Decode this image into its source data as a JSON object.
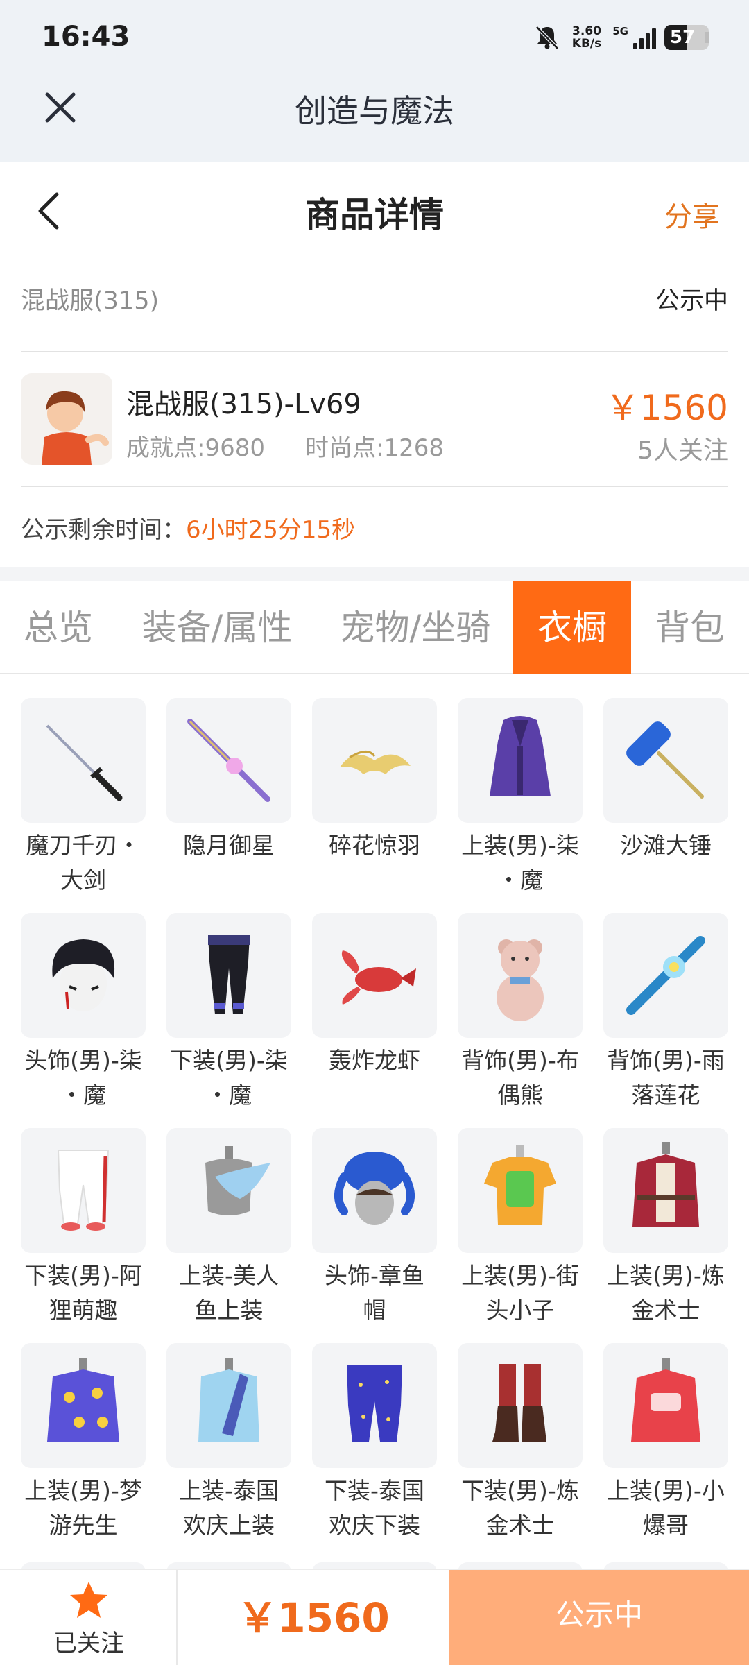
{
  "status_bar": {
    "time": "16:43",
    "net_speed_value": "3.60",
    "net_speed_unit": "KB/s",
    "network": "5G",
    "battery": "57",
    "battery_level": 0.57
  },
  "webview": {
    "title": "创造与魔法"
  },
  "nav": {
    "title": "商品详情",
    "share": "分享"
  },
  "listing": {
    "server": "混战服(315)",
    "status": "公示中",
    "character_name": "混战服(315)-Lv69",
    "achievement": "成就点:9680",
    "fashion": "时尚点:1268",
    "price": "￥1560",
    "followers": "5人关注",
    "remaining_label": "公示剩余时间：",
    "remaining_value": "6小时25分15秒"
  },
  "tabs": [
    {
      "label": "总览",
      "active": false
    },
    {
      "label": "装备/属性",
      "active": false
    },
    {
      "label": "宠物/坐骑",
      "active": false
    },
    {
      "label": "衣橱",
      "active": true
    },
    {
      "label": "背包",
      "active": false
    }
  ],
  "wardrobe": [
    {
      "name": "魔刀千刃·大剑",
      "line1": "魔刀千刃・",
      "line2": "大剑",
      "icon": "katana-icon"
    },
    {
      "name": "隐月御星",
      "line1": "隐月御星",
      "line2": "",
      "icon": "staff-sword-icon"
    },
    {
      "name": "碎花惊羽",
      "line1": "碎花惊羽",
      "line2": "",
      "icon": "golden-wings-icon"
    },
    {
      "name": "上装(男)-柒·魔",
      "line1": "上装(男)-柒",
      "line2": "・魔",
      "icon": "purple-coat-icon"
    },
    {
      "name": "沙滩大锤",
      "line1": "沙滩大锤",
      "line2": "",
      "icon": "hammer-icon"
    },
    {
      "name": "头饰(男)-柒·魔",
      "line1": "头饰(男)-柒",
      "line2": "・魔",
      "icon": "dark-hair-icon"
    },
    {
      "name": "下装(男)-柒·魔",
      "line1": "下装(男)-柒",
      "line2": "・魔",
      "icon": "dark-pants-icon"
    },
    {
      "name": "轰炸龙虾",
      "line1": "轰炸龙虾",
      "line2": "",
      "icon": "lobster-icon"
    },
    {
      "name": "背饰(男)-布偶熊",
      "line1": "背饰(男)-布",
      "line2": "偶熊",
      "icon": "teddy-bear-icon"
    },
    {
      "name": "背饰(男)-雨落莲花",
      "line1": "背饰(男)-雨",
      "line2": "落莲花",
      "icon": "lotus-umbrella-icon"
    },
    {
      "name": "下装(男)-阿狸萌趣",
      "line1": "下装(男)-阿",
      "line2": "狸萌趣",
      "icon": "white-pants-icon"
    },
    {
      "name": "上装-美人鱼上装",
      "line1": "上装-美人",
      "line2": "鱼上装",
      "icon": "mermaid-top-icon"
    },
    {
      "name": "头饰-章鱼帽",
      "line1": "头饰-章鱼",
      "line2": "帽",
      "icon": "octopus-hat-icon"
    },
    {
      "name": "上装(男)-街头小子",
      "line1": "上装(男)-街",
      "line2": "头小子",
      "icon": "street-shirt-icon"
    },
    {
      "name": "上装(男)-炼金术士",
      "line1": "上装(男)-炼",
      "line2": "金术士",
      "icon": "alchemist-coat-icon"
    },
    {
      "name": "上装(男)-梦游先生",
      "line1": "上装(男)-梦",
      "line2": "游先生",
      "icon": "pajama-top-icon"
    },
    {
      "name": "上装-泰国欢庆上装",
      "line1": "上装-泰国",
      "line2": "欢庆上装",
      "icon": "thai-top-icon"
    },
    {
      "name": "下装-泰国欢庆下装",
      "line1": "下装-泰国",
      "line2": "欢庆下装",
      "icon": "star-pants-icon"
    },
    {
      "name": "下装(男)-炼金术士",
      "line1": "下装(男)-炼",
      "line2": "金术士",
      "icon": "boots-icon"
    },
    {
      "name": "上装(男)-小爆哥",
      "line1": "上装(男)-小",
      "line2": "爆哥",
      "icon": "red-hoodie-icon"
    }
  ],
  "bottom_bar": {
    "follow_label": "已关注",
    "price": "￥1560",
    "status": "公示中"
  },
  "colors": {
    "accent": "#ff6a14",
    "price": "#f06a1c",
    "status_button": "#ffad7a",
    "header_band": "#eef2f6"
  }
}
